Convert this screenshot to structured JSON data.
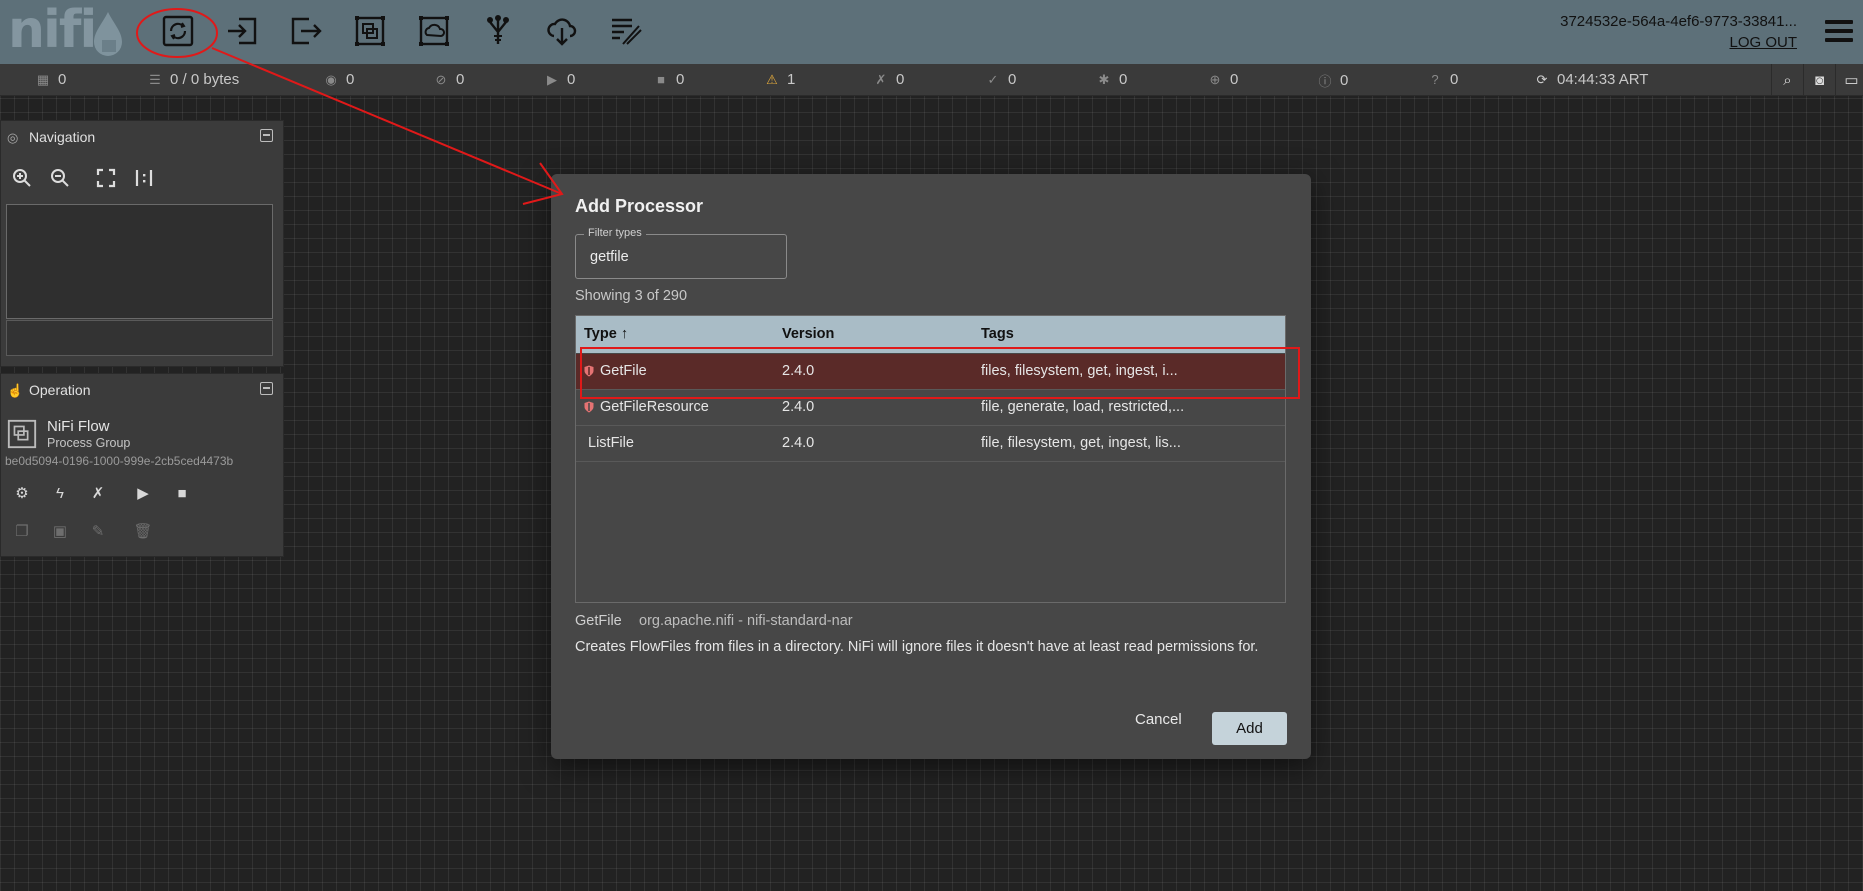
{
  "header": {
    "logo_text": "nifi",
    "user_id": "3724532e-564a-4ef6-9773-33841...",
    "logout_label": "LOG OUT",
    "toolbar": [
      {
        "name": "processor",
        "icon": "processor-icon"
      },
      {
        "name": "input-port",
        "icon": "input-port-icon"
      },
      {
        "name": "output-port",
        "icon": "output-port-icon"
      },
      {
        "name": "process-group",
        "icon": "process-group-icon"
      },
      {
        "name": "remote-process-group",
        "icon": "remote-process-group-icon"
      },
      {
        "name": "funnel",
        "icon": "funnel-icon"
      },
      {
        "name": "template",
        "icon": "cloud-download-icon"
      },
      {
        "name": "label",
        "icon": "label-icon"
      }
    ]
  },
  "status": {
    "cluster_nodes": "0",
    "queued": "0 / 0 bytes",
    "transmitting": "0",
    "not_transmitting": "0",
    "running": "0",
    "stopped": "0",
    "invalid": "1",
    "disabled": "0",
    "up_to_date": "0",
    "locally_modified": "0",
    "stale": "0",
    "locally_modified_stale": "0",
    "sync_failure": "0",
    "last_refreshed": "04:44:33 ART"
  },
  "navigation": {
    "title": "Navigation"
  },
  "operation": {
    "title": "Operation",
    "name": "NiFi Flow",
    "type": "Process Group",
    "id": "be0d5094-0196-1000-999e-2cb5ced4473b"
  },
  "dialog": {
    "title": "Add Processor",
    "filter_label": "Filter types",
    "filter_value": "getfile",
    "showing": "Showing 3 of 290",
    "columns": {
      "type": "Type",
      "sort_indicator": "↑",
      "version": "Version",
      "tags": "Tags"
    },
    "rows": [
      {
        "type": "GetFile",
        "version": "2.4.0",
        "tags": "files, filesystem, get, ingest, i...",
        "restricted": true,
        "selected": true
      },
      {
        "type": "GetFileResource",
        "version": "2.4.0",
        "tags": "file, generate, load, restricted,...",
        "restricted": true,
        "selected": false
      },
      {
        "type": "ListFile",
        "version": "2.4.0",
        "tags": "file, filesystem, get, ingest, lis...",
        "restricted": false,
        "selected": false
      }
    ],
    "selected_name": "GetFile",
    "selected_bundle": "org.apache.nifi - nifi-standard-nar",
    "selected_description": "Creates FlowFiles from files in a directory. NiFi will ignore files it doesn't have at least read permissions for.",
    "cancel_label": "Cancel",
    "add_label": "Add"
  },
  "colors": {
    "header_bg": "#5d7079",
    "selected_row": "#5a2a28",
    "table_header": "#a9bcc6",
    "annotation": "#e01919"
  }
}
